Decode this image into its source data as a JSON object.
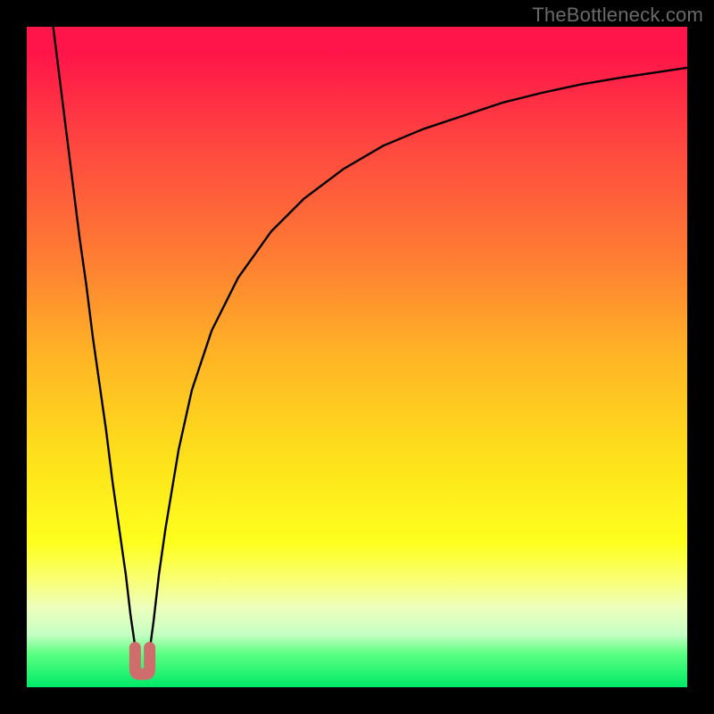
{
  "watermark": "TheBottleneck.com",
  "chart_data": {
    "type": "line",
    "title": "",
    "xlabel": "",
    "ylabel": "",
    "xlim": [
      0,
      100
    ],
    "ylim": [
      0,
      100
    ],
    "grid": false,
    "series": [
      {
        "name": "curve",
        "x": [
          4,
          5,
          6,
          7,
          8,
          9,
          10,
          11,
          12,
          13,
          14,
          15,
          15.7,
          16.5,
          17,
          17.3,
          17.8,
          18.2,
          18.6,
          19.2,
          20,
          21,
          22,
          23,
          25,
          28,
          32,
          37,
          42,
          48,
          54,
          60,
          66,
          72,
          78,
          84,
          90,
          96,
          100
        ],
        "y": [
          100,
          92,
          84,
          76,
          68,
          61,
          53,
          46,
          39,
          31,
          24,
          17,
          11,
          5.5,
          3,
          2.2,
          2.2,
          3,
          5.5,
          10,
          17,
          24,
          30,
          36,
          45,
          54,
          62,
          69,
          74,
          78.5,
          82,
          84.5,
          86.5,
          88.5,
          90,
          91.3,
          92.3,
          93.2,
          93.8
        ]
      }
    ],
    "marker_region": {
      "name": "minimum-marker",
      "color": "#cf6d6d",
      "x_range": [
        16.4,
        18.6
      ],
      "y_range": [
        2,
        6
      ]
    },
    "background_gradient": {
      "stops": [
        {
          "pos": 0,
          "color": "#ff1549"
        },
        {
          "pos": 18,
          "color": "#ff4740"
        },
        {
          "pos": 35,
          "color": "#fe7d33"
        },
        {
          "pos": 50,
          "color": "#ffb525"
        },
        {
          "pos": 65,
          "color": "#fde01b"
        },
        {
          "pos": 78,
          "color": "#feff1c"
        },
        {
          "pos": 88,
          "color": "#edffbe"
        },
        {
          "pos": 95,
          "color": "#5bff81"
        },
        {
          "pos": 100,
          "color": "#00e968"
        }
      ]
    }
  }
}
